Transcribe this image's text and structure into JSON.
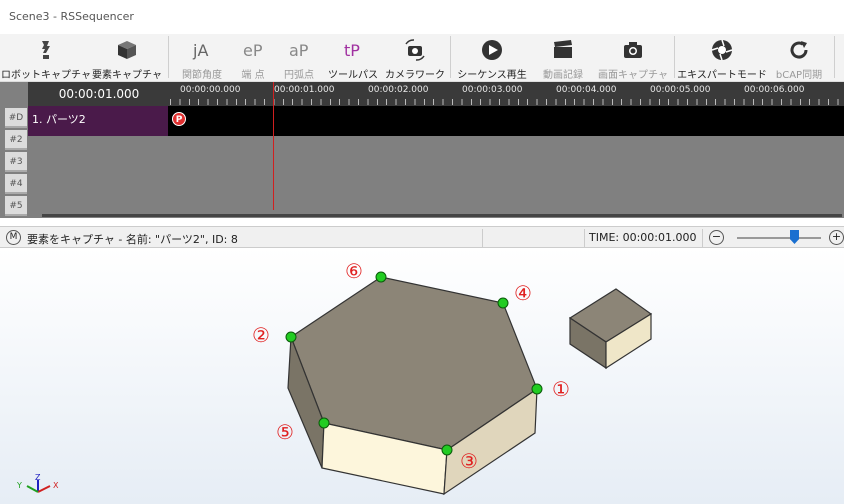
{
  "window": {
    "title": "Scene3 - RSSequencer"
  },
  "toolbar": {
    "robot_capture": "ロボットキャプチャ",
    "element_capture": "要素キャプチャ",
    "joint_angle": "関節角度",
    "endpoint": "端 点",
    "arc_point": "円弧点",
    "tool_path": "ツールパス",
    "camera_work": "カメラワーク",
    "sequence_play": "シーケンス再生",
    "video_record": "動画記録",
    "screen_capture": "画面キャプチャ",
    "expert_mode": "エキスパートモード",
    "bcap_sync": "bCAP同期"
  },
  "timeline": {
    "current_time": "00:00:01.000",
    "ticks": [
      "00:00:00.000",
      "00:00:01.000",
      "00:00:02.000",
      "00:00:03.000",
      "00:00:04.000",
      "00:00:05.000",
      "00:00:06.000"
    ],
    "rows": [
      "#D",
      "#2",
      "#3",
      "#4",
      "#5"
    ],
    "track1_label": "1. パーツ2",
    "marker_label": "P"
  },
  "status": {
    "mode_button": "M",
    "message": "要素をキャプチャ - 名前: \"パーツ2\", ID: 8",
    "time_label": "TIME: 00:00:01.000",
    "zoom_out": "−",
    "zoom_in": "+"
  },
  "viewport": {
    "point_labels": [
      "①",
      "②",
      "③",
      "④",
      "⑤",
      "⑥"
    ],
    "axis_x": "X",
    "axis_y": "Y",
    "axis_z": "Z",
    "colors": {
      "marker": "#22cc22",
      "label": "#e02020",
      "top_face": "#8c8577",
      "side_face": "#fdf6dc"
    }
  }
}
